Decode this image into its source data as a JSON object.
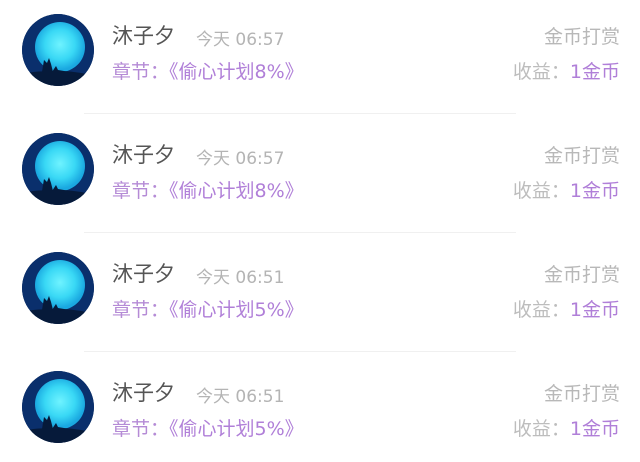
{
  "records": [
    {
      "name": "沐子夕",
      "time": "今天 06:57",
      "type": "金币打赏",
      "chapter_label": "章节：",
      "chapter_title": "《偷心计划8%》",
      "income_label": "收益：",
      "income_value": "1金币"
    },
    {
      "name": "沐子夕",
      "time": "今天 06:57",
      "type": "金币打赏",
      "chapter_label": "章节：",
      "chapter_title": "《偷心计划8%》",
      "income_label": "收益：",
      "income_value": "1金币"
    },
    {
      "name": "沐子夕",
      "time": "今天 06:51",
      "type": "金币打赏",
      "chapter_label": "章节：",
      "chapter_title": "《偷心计划5%》",
      "income_label": "收益：",
      "income_value": "1金币"
    },
    {
      "name": "沐子夕",
      "time": "今天 06:51",
      "type": "金币打赏",
      "chapter_label": "章节：",
      "chapter_title": "《偷心计划5%》",
      "income_label": "收益：",
      "income_value": "1金币"
    }
  ],
  "colors": {
    "accent_purple": "#b07fd8",
    "name_gray": "#555555",
    "muted_gray": "#b4b4b4"
  }
}
